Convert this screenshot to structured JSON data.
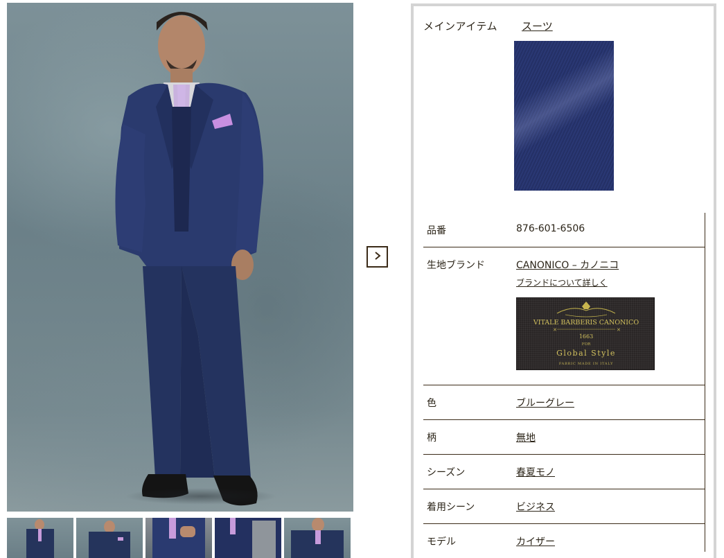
{
  "gallery": {
    "main_image_alt": "navy three-piece suit model",
    "next_icon": "chevron-right-icon",
    "thumbnails": [
      "thumb-1",
      "thumb-2",
      "thumb-3",
      "thumb-4",
      "thumb-5"
    ]
  },
  "details": {
    "main_item": {
      "label": "メインアイテム",
      "value": "スーツ"
    },
    "specs": [
      {
        "label": "品番",
        "value": "876-601-6506"
      },
      {
        "label": "生地ブランド",
        "value": "CANONICO – カノニコ",
        "sub_link": "ブランドについて詳しく"
      },
      {
        "label": "色",
        "value": "ブルーグレー"
      },
      {
        "label": "柄",
        "value": "無地"
      },
      {
        "label": "シーズン",
        "value": "春夏モノ"
      },
      {
        "label": "着用シーン",
        "value": "ビジネス"
      },
      {
        "label": "モデル",
        "value": "カイザー"
      }
    ],
    "brand_label": {
      "line1": "VITALE BARBERIS CANONICO",
      "year": "1663",
      "for": "FOR",
      "line2": "Global Style",
      "line3": "FABRIC MADE IN ITALY"
    }
  },
  "colors": {
    "accent_text": "#2b2418",
    "border": "#3a2a17",
    "suit_navy": "#263372"
  }
}
